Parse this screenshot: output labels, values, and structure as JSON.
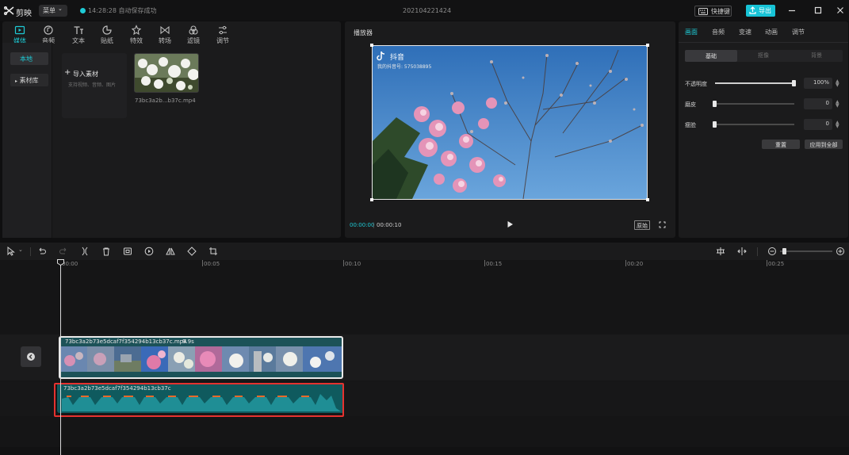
{
  "titlebar": {
    "app_name": "剪映",
    "menu_label": "菜单",
    "save_status": "14:28:28 自动保存成功",
    "project_title": "202104221424",
    "shortcut_label": "快捷键",
    "export_label": "导出",
    "accent": "#1ecbd6"
  },
  "media": {
    "tabs": [
      {
        "label": "媒体",
        "icon": "media-icon"
      },
      {
        "label": "音频",
        "icon": "audio-icon"
      },
      {
        "label": "文本",
        "icon": "text-icon"
      },
      {
        "label": "贴纸",
        "icon": "sticker-icon"
      },
      {
        "label": "特效",
        "icon": "effects-icon"
      },
      {
        "label": "转场",
        "icon": "transition-icon"
      },
      {
        "label": "滤镜",
        "icon": "filter-icon"
      },
      {
        "label": "调节",
        "icon": "adjust-icon"
      }
    ],
    "side": {
      "local": "本地",
      "library": "素材库"
    },
    "import_label": "导入素材",
    "import_hint": "支持视频、音频、图片",
    "file_name": "73bc3a2b...b37c.mp4"
  },
  "player": {
    "title": "播放器",
    "watermark": "抖音",
    "watermark_id": "我的抖音号: 575038895",
    "time_current": "00:00:00",
    "time_total": "00:00:10",
    "ratio_label": "原始"
  },
  "props": {
    "tabs": [
      "画面",
      "音频",
      "变速",
      "动画",
      "调节"
    ],
    "subtabs": [
      "基础",
      "抠像",
      "背景"
    ],
    "opacity_label": "不透明度",
    "opacity_value": "100%",
    "opacity_fraction": 1.0,
    "smooth_label": "磨皮",
    "smooth_value": "0",
    "slim_label": "瘦脸",
    "slim_value": "0",
    "reset_label": "重置",
    "apply_all_label": "应用到全部"
  },
  "timeline": {
    "ticks": [
      "00:00",
      "00:05",
      "00:10",
      "00:15",
      "00:20",
      "00:25"
    ],
    "video_clip_name": "73bc3a2b73e5dcaf7f354294b13cb37c.mp4",
    "video_clip_duration": "9.9s",
    "audio_clip_name": "73bc3a2b73e5dcaf7f354294b13cb37c",
    "highlight_color": "#e5322f"
  }
}
